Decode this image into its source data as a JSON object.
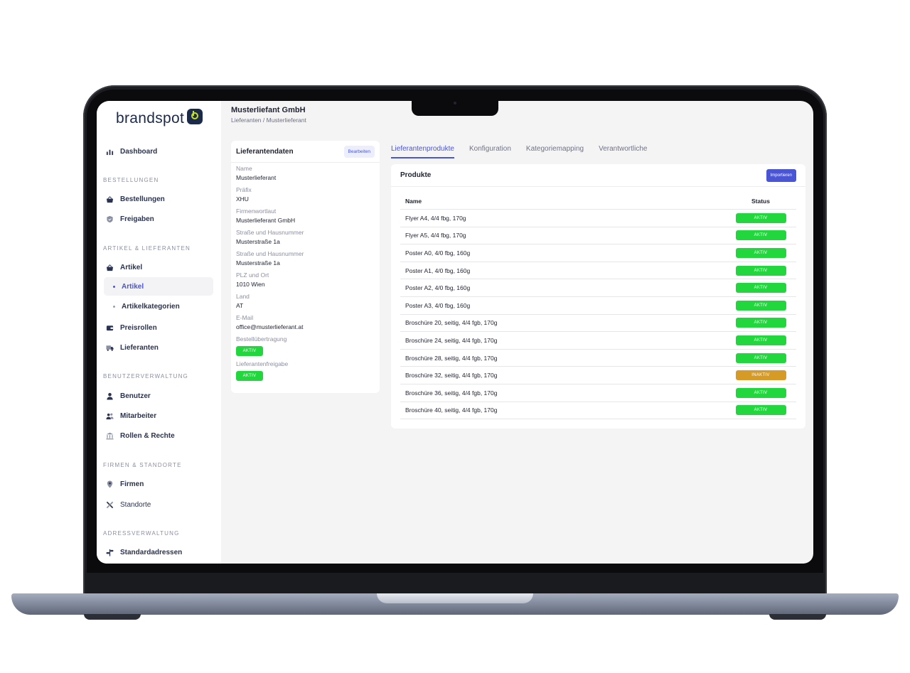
{
  "app": {
    "logo_text": "brandspot"
  },
  "header": {
    "title": "Musterliefant GmbH",
    "breadcrumb": "Lieferanten / Musterlieferant"
  },
  "sidebar": {
    "dashboard": "Dashboard",
    "sections": {
      "orders": "BESTELLUNGEN",
      "articles": "ARTIKEL & LIEFERANTEN",
      "users": "BENUTZERVERWALTUNG",
      "companies": "FIRMEN & STANDORTE",
      "addresses": "ADRESSVERWALTUNG"
    },
    "items": {
      "bestellungen": "Bestellungen",
      "freigaben": "Freigaben",
      "artikel": "Artikel",
      "artikel_sub": "Artikel",
      "artikelkategorien": "Artikelkategorien",
      "preisrollen": "Preisrollen",
      "lieferanten": "Lieferanten",
      "benutzer": "Benutzer",
      "mitarbeiter": "Mitarbeiter",
      "rollen": "Rollen & Rechte",
      "firmen": "Firmen",
      "standorte": "Standorte",
      "standardadressen": "Standardadressen"
    }
  },
  "supplier": {
    "title": "Lieferantendaten",
    "edit_label": "Bearbeiten",
    "fields": [
      {
        "label": "Name",
        "value": "Musterlieferant"
      },
      {
        "label": "Präfix",
        "value": "XHU"
      },
      {
        "label": "Firmenwortlaut",
        "value": "Musterlieferant GmbH"
      },
      {
        "label": "Straße und Hausnummer",
        "value": "Musterstraße 1a"
      },
      {
        "label": "Straße und Hausnummer",
        "value": "Musterstraße 1a"
      },
      {
        "label": "PLZ und Ort",
        "value": "1010 Wien"
      },
      {
        "label": "Land",
        "value": "AT"
      },
      {
        "label": "E-Mail",
        "value": "office@musterlieferant.at"
      }
    ],
    "order_transfer": {
      "label": "Bestellübertragung",
      "status": "AKTIV"
    },
    "supplier_release": {
      "label": "Lieferantenfreigabe",
      "status": "AKTIV"
    }
  },
  "tabs": [
    {
      "label": "Lieferantenprodukte",
      "active": true
    },
    {
      "label": "Konfiguration",
      "active": false
    },
    {
      "label": "Kategoriemapping",
      "active": false
    },
    {
      "label": "Verantwortliche",
      "active": false
    }
  ],
  "products": {
    "title": "Produkte",
    "import_label": "Importieren",
    "columns": {
      "name": "Name",
      "status": "Status"
    },
    "rows": [
      {
        "name": "Flyer A4, 4/4 fbg, 170g",
        "status": "AKTIV"
      },
      {
        "name": "Flyer A5, 4/4 fbg, 170g",
        "status": "AKTIV"
      },
      {
        "name": "Poster A0, 4/0 fbg, 160g",
        "status": "AKTIV"
      },
      {
        "name": "Poster A1, 4/0 fbg, 160g",
        "status": "AKTIV"
      },
      {
        "name": "Poster A2, 4/0 fbg, 160g",
        "status": "AKTIV"
      },
      {
        "name": "Poster A3, 4/0 fbg, 160g",
        "status": "AKTIV"
      },
      {
        "name": "Broschüre 20, seitig, 4/4 fgb, 170g",
        "status": "AKTIV"
      },
      {
        "name": "Broschüre 24, seitig, 4/4 fgb, 170g",
        "status": "AKTIV"
      },
      {
        "name": "Broschüre 28, seitig, 4/4 fgb, 170g",
        "status": "AKTIV"
      },
      {
        "name": "Broschüre 32, seitig, 4/4 fgb, 170g",
        "status": "INAKTIV"
      },
      {
        "name": "Broschüre 36, seitig, 4/4 fgb, 170g",
        "status": "AKTIV"
      },
      {
        "name": "Broschüre 40, seitig, 4/4 fgb, 170g",
        "status": "AKTIV"
      }
    ]
  },
  "colors": {
    "accent": "#4a55d6",
    "active_badge": "#22d63e",
    "inactive_badge": "#d69b27",
    "logo_navy": "#1b2a4a",
    "logo_lime": "#c7e021"
  }
}
